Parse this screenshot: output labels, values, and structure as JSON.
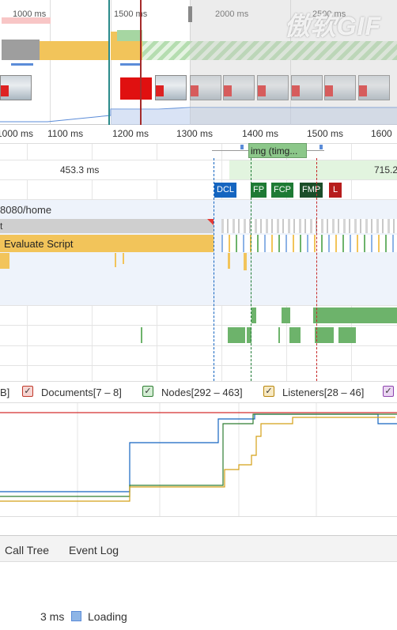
{
  "overview": {
    "ticks": [
      "1000 ms",
      "1500 ms",
      "2000 ms",
      "2500 ms"
    ],
    "watermark": "傲软GIF"
  },
  "ruler": {
    "ticks": [
      "1000 ms",
      "1100 ms",
      "1200 ms",
      "1300 ms",
      "1400 ms",
      "1500 ms",
      "1600"
    ]
  },
  "network": {
    "item_label": "img (timg...",
    "duration_left": "453.3 ms",
    "duration_right": "715.2"
  },
  "markers": {
    "dcl": "DCL",
    "fp": "FP",
    "fcp": "FCP",
    "fmp": "FMP",
    "l": "L"
  },
  "main": {
    "url_label": "8080/home",
    "task_label": "t",
    "evaluate_label": "Evaluate Script"
  },
  "legend": {
    "partial_left": "B]",
    "documents": "Documents[7 – 8]",
    "nodes": "Nodes[292 – 463]",
    "listeners": "Listeners[28 – 46]"
  },
  "tabs": {
    "call_tree": "Call Tree",
    "event_log": "Event Log"
  },
  "summary": {
    "value": "3 ms",
    "loading_label": "Loading"
  },
  "colors": {
    "scripting": "#f2c45a",
    "painting": "#6db36b",
    "loading": "#8eb5e6",
    "dcl": "#1565c0",
    "fp": "#1e7a34",
    "fmp": "#1b4d28",
    "l": "#b71c1c"
  }
}
